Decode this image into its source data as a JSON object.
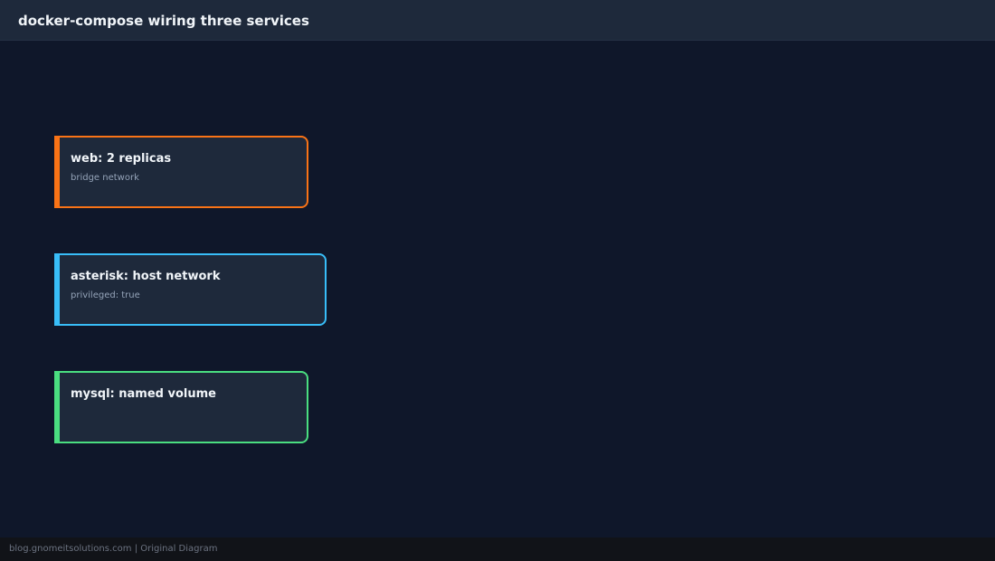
{
  "header": {
    "title": "docker-compose wiring three services"
  },
  "services": [
    {
      "title": "web: 2 replicas",
      "subtitle": "bridge network",
      "accent_color": "#f97316"
    },
    {
      "title": "asterisk: host network",
      "subtitle": "privileged: true",
      "accent_color": "#38bdf8"
    },
    {
      "title": "mysql: named volume",
      "subtitle": "",
      "accent_color": "#4ade80"
    }
  ],
  "footer": {
    "text": "blog.gnomeitsolutions.com | Original Diagram"
  }
}
